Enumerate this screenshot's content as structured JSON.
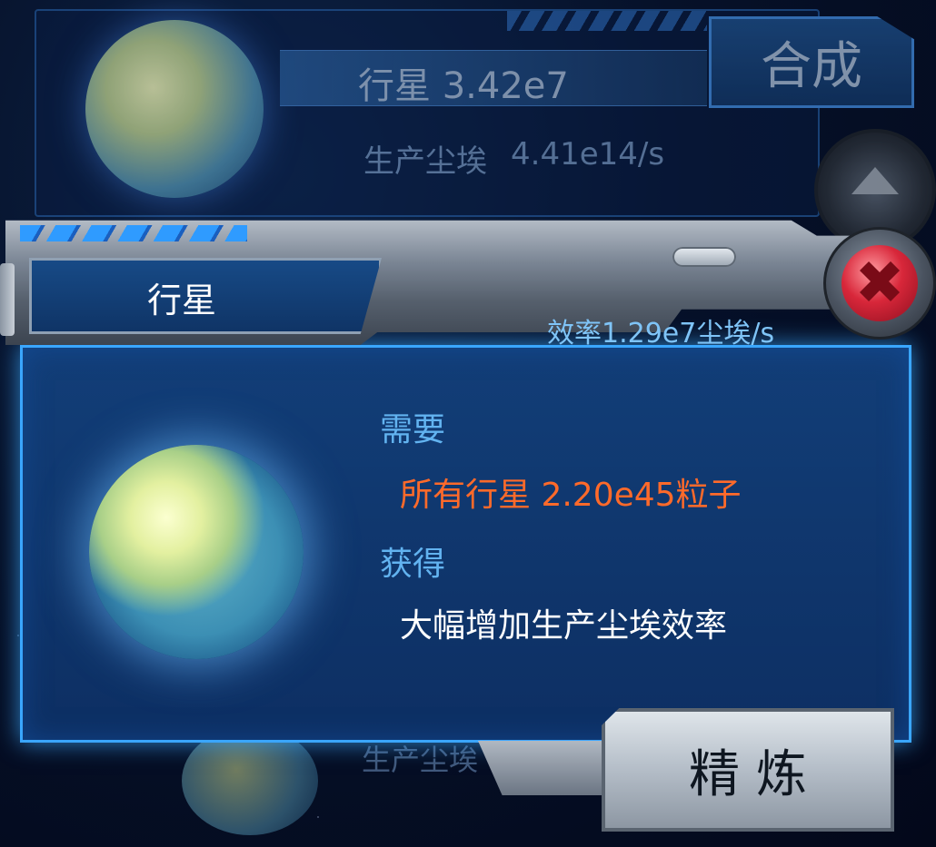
{
  "background_card": {
    "title": "行星 3.42e7",
    "production_label": "生产尘埃",
    "production_value": "4.41e14/s",
    "synthesize_label": "合成",
    "lower_production_label": "生产尘埃"
  },
  "dialog": {
    "title": "行星",
    "efficiency": "效率1.29e7尘埃/s",
    "need_label": "需要",
    "need_value": "所有行星 2.20e45粒子",
    "gain_label": "获得",
    "gain_value": "大幅增加生产尘埃效率",
    "refine_label": "精炼",
    "close_symbol": "✖"
  },
  "icons": {
    "planet": "planet-icon",
    "close": "close-icon",
    "upgrade": "up-arrow-icon"
  },
  "colors": {
    "need_value": "#ff6a2a",
    "section_label": "#62b3f0",
    "efficiency": "#7fc4f7",
    "panel_border": "#3aa6ff"
  }
}
